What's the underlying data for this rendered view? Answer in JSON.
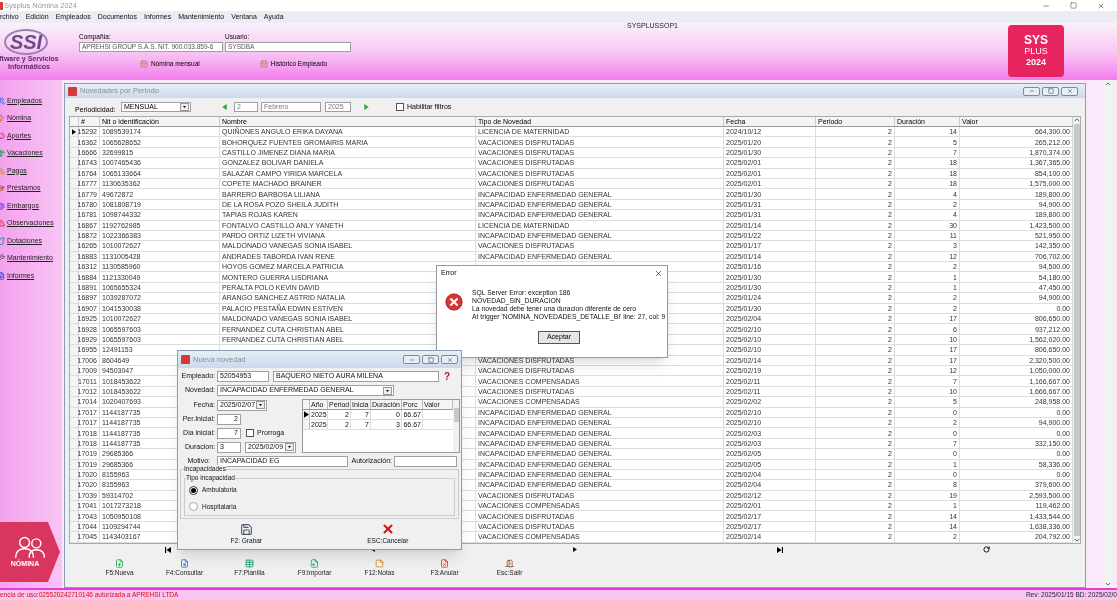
{
  "window": {
    "title": "Sysplus Nómina 2024"
  },
  "menu": [
    "rchivo",
    "Edición",
    "Empleados",
    "Documentos",
    "Informes",
    "Mantenimiento",
    "Ventana",
    "Ayuda"
  ],
  "station": "SYSPLUSSOP1",
  "logo": {
    "mark": "SSI",
    "tagline": [
      "ftware y Servicios",
      "Informáticos"
    ]
  },
  "company": {
    "label": "Compañía:",
    "value": "APREHSI GROUP S.A.S.  NIT. 900.033.859-6"
  },
  "user": {
    "label": "Usuario:",
    "value": "SYSDBA"
  },
  "shortcuts": [
    "Nómina mensual",
    "Histórico Empleado"
  ],
  "brand_badge": [
    "SYS",
    "PLUS",
    "2024"
  ],
  "sidebar": {
    "items": [
      "Empleados",
      "Nómina",
      "Aportes",
      "Vacaciones",
      "Pagos",
      "Préstamos",
      "Embargos",
      "Observaciones",
      "Dotaciones",
      "Mantenimiento",
      "Informes"
    ],
    "badge": "NÓMINA"
  },
  "novedades": {
    "title": "Novedades por Periodo",
    "toolbar": {
      "periodicidad_label": "Periodicidad:",
      "periodicidad": "MENSUAL",
      "period": "2",
      "month": "Febrero",
      "year": "2025",
      "filter": {
        "label": "Habilitar filtros",
        "checked": false
      }
    },
    "table": {
      "columns": [
        "#",
        "Nit o identificación",
        "Nombre",
        "Tipo de Novedad",
        "Fecha",
        "Periodo",
        "Duración",
        "Valor"
      ],
      "rows": [
        {
          "selected": true,
          "id": "15292",
          "nit": "1089539174",
          "name": "QUIÑONES ANGULO ERIKA DAYANA",
          "type": "LICENCIA DE MATERNIDAD",
          "date": "2024/10/12",
          "period": "2",
          "duration": "14",
          "value": "664,300.00"
        },
        {
          "selected": false,
          "id": "16362",
          "nit": "1065628652",
          "name": "BOHORQUEZ FUENTES GROMAIRIS MARIA",
          "type": "VACACIONES DISFRUTADAS",
          "date": "2025/01/20",
          "period": "2",
          "duration": "5",
          "value": "265,212.00"
        },
        {
          "selected": false,
          "id": "16666",
          "nit": "32699815",
          "name": "CASTILLO JIMENEZ DIANA MARIA",
          "type": "VACACIONES DISFRUTADAS",
          "date": "2025/01/30",
          "period": "2",
          "duration": "7",
          "value": "1,870,374.00"
        },
        {
          "selected": false,
          "id": "16743",
          "nit": "1007465436",
          "name": "GONZALEZ BOLIVAR DANIELA",
          "type": "VACACIONES DISFRUTADAS",
          "date": "2025/02/01",
          "period": "2",
          "duration": "18",
          "value": "1,367,365.00"
        },
        {
          "selected": false,
          "id": "16764",
          "nit": "1065133664",
          "name": "SALAZAR CAMPO YIRIDA MARCELA",
          "type": "VACACIONES DISFRUTADAS",
          "date": "2025/02/01",
          "period": "2",
          "duration": "18",
          "value": "854,100.00"
        },
        {
          "selected": false,
          "id": "16777",
          "nit": "1130635362",
          "name": "COPETE MACHADO BRAINER",
          "type": "VACACIONES DISFRUTADAS",
          "date": "2025/02/01",
          "period": "2",
          "duration": "18",
          "value": "1,575,000.00"
        },
        {
          "selected": false,
          "id": "16779",
          "nit": "49672872",
          "name": "BARRERO BARBOSA LILIANA",
          "type": "INCAPACIDAD ENFERMEDAD GENERAL",
          "date": "2025/01/30",
          "period": "2",
          "duration": "4",
          "value": "189,800.00"
        },
        {
          "selected": false,
          "id": "16780",
          "nit": "1081808719",
          "name": "DE LA ROSA POZO SHEILA JUDITH",
          "type": "INCAPACIDAD ENFERMEDAD GENERAL",
          "date": "2025/01/31",
          "period": "2",
          "duration": "2",
          "value": "94,900.00"
        },
        {
          "selected": false,
          "id": "16781",
          "nit": "1098744332",
          "name": "TAPIAS ROJAS KAREN",
          "type": "INCAPACIDAD ENFERMEDAD GENERAL",
          "date": "2025/01/31",
          "period": "2",
          "duration": "4",
          "value": "189,800.00"
        },
        {
          "selected": false,
          "id": "16867",
          "nit": "1192762985",
          "name": "FONTALVO CASTILLO ANLY YANETH",
          "type": "LICENCIA DE MATERNIDAD",
          "date": "2025/01/14",
          "period": "2",
          "duration": "30",
          "value": "1,423,500.00"
        },
        {
          "selected": false,
          "id": "16872",
          "nit": "1022366383",
          "name": "PARDO ORTIZ LIZETH VIVIANA",
          "type": "INCAPACIDAD ENFERMEDAD GENERAL",
          "date": "2025/01/22",
          "period": "2",
          "duration": "11",
          "value": "521,950.00"
        },
        {
          "selected": false,
          "id": "16265",
          "nit": "1010072627",
          "name": "MALDONADO VANEGAS SONIA ISABEL",
          "type": "VACACIONES DISFRUTADAS",
          "date": "2025/01/17",
          "period": "2",
          "duration": "3",
          "value": "142,350.00"
        },
        {
          "selected": false,
          "id": "16883",
          "nit": "1131005428",
          "name": "ANDRADES TABORDA IVAN RENE",
          "type": "INCAPACIDAD ENFERMEDAD GENERAL",
          "date": "2025/01/14",
          "period": "2",
          "duration": "12",
          "value": "706,702.00"
        },
        {
          "selected": false,
          "id": "16312",
          "nit": "1130585960",
          "name": "HOYOS GOMEZ MARCELA PATRICIA",
          "date": "2025/01/16",
          "period": "2",
          "duration": "2",
          "value": "94,500.00"
        },
        {
          "selected": false,
          "id": "16884",
          "nit": "1121330049",
          "name": "MONTERO GUERRA LISDRIANA",
          "date": "2025/01/30",
          "period": "2",
          "duration": "1",
          "value": "54,180.00"
        },
        {
          "selected": false,
          "id": "16891",
          "nit": "1065655324",
          "name": "PERALTA POLO KEVIN DAVID",
          "date": "2025/01/30",
          "period": "2",
          "duration": "1",
          "value": "47,450.00"
        },
        {
          "selected": false,
          "id": "16897",
          "nit": "1039287072",
          "name": "ARANGO SANCHEZ ASTRID NATALIA",
          "date": "2025/01/24",
          "period": "2",
          "duration": "2",
          "value": "94,900.00"
        },
        {
          "selected": false,
          "id": "16907",
          "nit": "1041530038",
          "name": "PALACIO PESTAÑA EDWIN ESTIVEN",
          "date": "2025/01/30",
          "period": "2",
          "duration": "2",
          "value": "0.00"
        },
        {
          "selected": false,
          "id": "16925",
          "nit": "1010072627",
          "name": "MALDONADO VANEGAS SONIA ISABEL",
          "date": "2025/02/04",
          "period": "2",
          "duration": "17",
          "value": "806,650.00"
        },
        {
          "selected": false,
          "id": "16928",
          "nit": "1065597603",
          "name": "FERNANDEZ CUTA CHRISTIAN ABEL",
          "date": "2025/02/10",
          "period": "2",
          "duration": "6",
          "value": "937,212.00"
        },
        {
          "selected": false,
          "id": "16929",
          "nit": "1065597603",
          "name": "FERNANDEZ CUTA CHRISTIAN ABEL",
          "date": "2025/02/10",
          "period": "2",
          "duration": "10",
          "value": "1,562,020.00"
        },
        {
          "selected": false,
          "id": "16955",
          "nit": "12491153",
          "date": "2025/02/10",
          "period": "2",
          "duration": "17",
          "value": "806,650.00"
        },
        {
          "selected": false,
          "id": "17006",
          "nit": "8604649",
          "type": "VACACIONES DISFRUTADAS",
          "date": "2025/02/14",
          "period": "2",
          "duration": "17",
          "value": "2,320,500.00"
        },
        {
          "selected": false,
          "id": "17009",
          "nit": "94503047",
          "type": "VACACIONES DISFRUTADAS",
          "date": "2025/02/19",
          "period": "2",
          "duration": "12",
          "value": "1,050,000.00"
        },
        {
          "selected": false,
          "id": "17011",
          "nit": "1018453622",
          "type": "VACACIONES COMPENSADAS",
          "date": "2025/02/11",
          "period": "2",
          "duration": "7",
          "value": "1,166,667.00"
        },
        {
          "selected": false,
          "id": "17012",
          "nit": "1018453622",
          "type": "VACACIONES DISFRUTADAS",
          "date": "2025/02/11",
          "period": "2",
          "duration": "10",
          "value": "1,666,667.00"
        },
        {
          "selected": false,
          "id": "17014",
          "nit": "1020407693",
          "type": "VACACIONES COMPENSADAS",
          "date": "2025/02/02",
          "period": "2",
          "duration": "5",
          "value": "248,958.00"
        },
        {
          "selected": false,
          "id": "17017",
          "nit": "1144187735",
          "type": "INCAPACIDAD ENFERMEDAD GENERAL",
          "date": "2025/02/10",
          "period": "2",
          "duration": "0",
          "value": "0.00"
        },
        {
          "selected": false,
          "id": "17017",
          "nit": "1144187735",
          "type": "INCAPACIDAD ENFERMEDAD GENERAL",
          "date": "2025/02/10",
          "period": "2",
          "duration": "2",
          "value": "94,900.00"
        },
        {
          "selected": false,
          "id": "17018",
          "nit": "1144187735",
          "type": "INCAPACIDAD ENFERMEDAD GENERAL",
          "date": "2025/02/03",
          "period": "2",
          "duration": "0",
          "value": "0.00"
        },
        {
          "selected": false,
          "id": "17018",
          "nit": "1144187735",
          "type": "INCAPACIDAD ENFERMEDAD GENERAL",
          "date": "2025/02/03",
          "period": "2",
          "duration": "7",
          "value": "332,150.00"
        },
        {
          "selected": false,
          "id": "17019",
          "nit": "29685366",
          "type": "INCAPACIDAD ENFERMEDAD GENERAL",
          "date": "2025/02/05",
          "period": "2",
          "duration": "0",
          "value": "0.00"
        },
        {
          "selected": false,
          "id": "17019",
          "nit": "29685366",
          "type": "INCAPACIDAD ENFERMEDAD GENERAL",
          "date": "2025/02/05",
          "period": "2",
          "duration": "1",
          "value": "58,336.00"
        },
        {
          "selected": false,
          "id": "17020",
          "nit": "8155963",
          "type": "INCAPACIDAD ENFERMEDAD GENERAL",
          "date": "2025/02/04",
          "period": "2",
          "duration": "0",
          "value": "0.00"
        },
        {
          "selected": false,
          "id": "17020",
          "nit": "8155963",
          "type": "INCAPACIDAD ENFERMEDAD GENERAL",
          "date": "2025/02/04",
          "period": "2",
          "duration": "8",
          "value": "379,600.00"
        },
        {
          "selected": false,
          "id": "17039",
          "nit": "59314702",
          "type": "VACACIONES DISFRUTADAS",
          "date": "2025/02/12",
          "period": "2",
          "duration": "19",
          "value": "2,593,500.00"
        },
        {
          "selected": false,
          "id": "17041",
          "nit": "1017273218",
          "type": "VACACIONES COMPENSADAS",
          "date": "2025/02/01",
          "period": "2",
          "duration": "1",
          "value": "119,462.00"
        },
        {
          "selected": false,
          "id": "17043",
          "nit": "1050950108",
          "type": "VACACIONES DISFRUTADAS",
          "date": "2025/02/17",
          "period": "2",
          "duration": "14",
          "value": "1,433,544.00"
        },
        {
          "selected": false,
          "id": "17044",
          "nit": "1109294744",
          "type": "VACACIONES DISFRUTADAS",
          "date": "2025/02/17",
          "period": "2",
          "duration": "14",
          "value": "1,638,336.00"
        },
        {
          "selected": false,
          "id": "17045",
          "nit": "1143403167",
          "type": "VACACIONES COMPENSADAS",
          "date": "2025/02/14",
          "period": "2",
          "duration": "2",
          "value": "204,792.00"
        }
      ]
    },
    "actions": [
      "F5:Nueva",
      "F4:Consultar",
      "F7:Planilla",
      "F9:Importar",
      "F12:Notas",
      "F3:Anular",
      "Esc:Salir"
    ]
  },
  "status_bar": {
    "license": "encia de uso:025520242710146 autorizada a APREHSI LTDA",
    "revision": "Rev: 2025/01/15 BD: 2025/02/0"
  },
  "error_dialog": {
    "title": "Error",
    "lines": [
      "SQL Server Error: exception 186",
      "NOVEDAD_SIN_DURACION",
      "La novedad debe tener una duracion diferente de cero",
      "At trigger 'NOMINA_NOVEDADES_DETALLE_BI' line: 27, col: 9"
    ],
    "button": "Aceptar"
  },
  "nueva_novedad": {
    "title": "Nueva novedad",
    "empleado": {
      "label": "Empleado:",
      "code": "52054953",
      "name": "BAQUERO NIETO AURA MILENA",
      "help": "?"
    },
    "novedad": {
      "label": "Novedad:",
      "value": "INCAPACIDAD ENFERMEDAD GENERAL"
    },
    "fecha": {
      "label": "Fecha:",
      "value": "2025/02/07"
    },
    "per_inicial": {
      "label": "Per.Inicial:",
      "value": "2"
    },
    "dia_inicial": {
      "label": "Dia inicial:",
      "value": "7"
    },
    "prorroga": {
      "label": "Prorroga",
      "checked": false
    },
    "duracion": {
      "label": "Duracion:",
      "value": "3",
      "end_date": "2025/02/09"
    },
    "grid": {
      "columns": [
        "Año",
        "Period",
        "Inicia",
        "Duración",
        "Porc",
        "Valor"
      ],
      "rows": [
        {
          "selected": true,
          "cells": [
            "2025",
            "2",
            "7",
            "0",
            "66.67"
          ]
        },
        {
          "selected": false,
          "cells": [
            "2025",
            "2",
            "7",
            "3",
            "66.67"
          ]
        }
      ]
    },
    "motivo": {
      "label": "Motivo:",
      "value": "INCAPACIDAD EG"
    },
    "autorizacion": {
      "label": "Autorización:"
    },
    "incapacidades": {
      "label": "Incapacidades",
      "tipo_label": "Tipo incapacidad",
      "options": [
        {
          "label": "Ambulatoria",
          "selected": true
        },
        {
          "label": "Hospitalaria",
          "selected": false
        }
      ]
    },
    "buttons": [
      "F2: Grabar",
      "ESC:Cancelar"
    ]
  }
}
